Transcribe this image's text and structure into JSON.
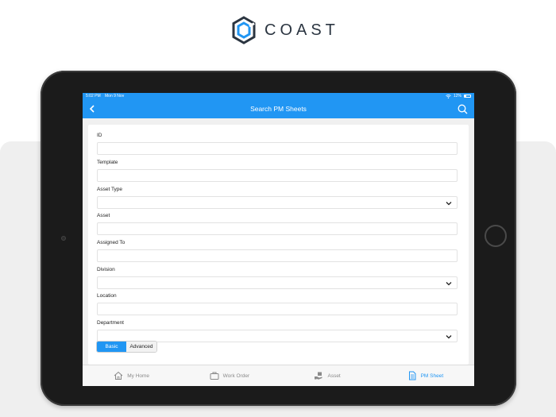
{
  "brand": {
    "name": "COAST"
  },
  "status_bar": {
    "time": "5:02 PM",
    "date": "Mon 9 Nov",
    "battery": "12%",
    "wifi_icon": "wifi-icon",
    "battery_icon": "battery-icon"
  },
  "nav": {
    "title": "Search PM Sheets",
    "back_icon": "chevron-left-icon",
    "search_icon": "search-icon"
  },
  "form": {
    "fields": [
      {
        "label": "ID",
        "type": "text",
        "value": ""
      },
      {
        "label": "Template",
        "type": "text",
        "value": ""
      },
      {
        "label": "Asset Type",
        "type": "select",
        "value": ""
      },
      {
        "label": "Asset",
        "type": "text",
        "value": ""
      },
      {
        "label": "Assigned To",
        "type": "text",
        "value": ""
      },
      {
        "label": "Division",
        "type": "select",
        "value": ""
      },
      {
        "label": "Location",
        "type": "text",
        "value": ""
      },
      {
        "label": "Department",
        "type": "select",
        "value": ""
      }
    ],
    "mode_toggle": {
      "basic": "Basic",
      "advanced": "Advanced",
      "selected": "Basic"
    }
  },
  "tabs": [
    {
      "label": "My Home",
      "icon": "home-icon",
      "active": false
    },
    {
      "label": "Work Order",
      "icon": "briefcase-icon",
      "active": false
    },
    {
      "label": "Asset",
      "icon": "hand-box-icon",
      "active": false
    },
    {
      "label": "PM Sheet",
      "icon": "document-icon",
      "active": true
    }
  ],
  "colors": {
    "accent": "#2196f3",
    "brand_text": "#2b3541",
    "device_frame": "#1b1b1b"
  }
}
